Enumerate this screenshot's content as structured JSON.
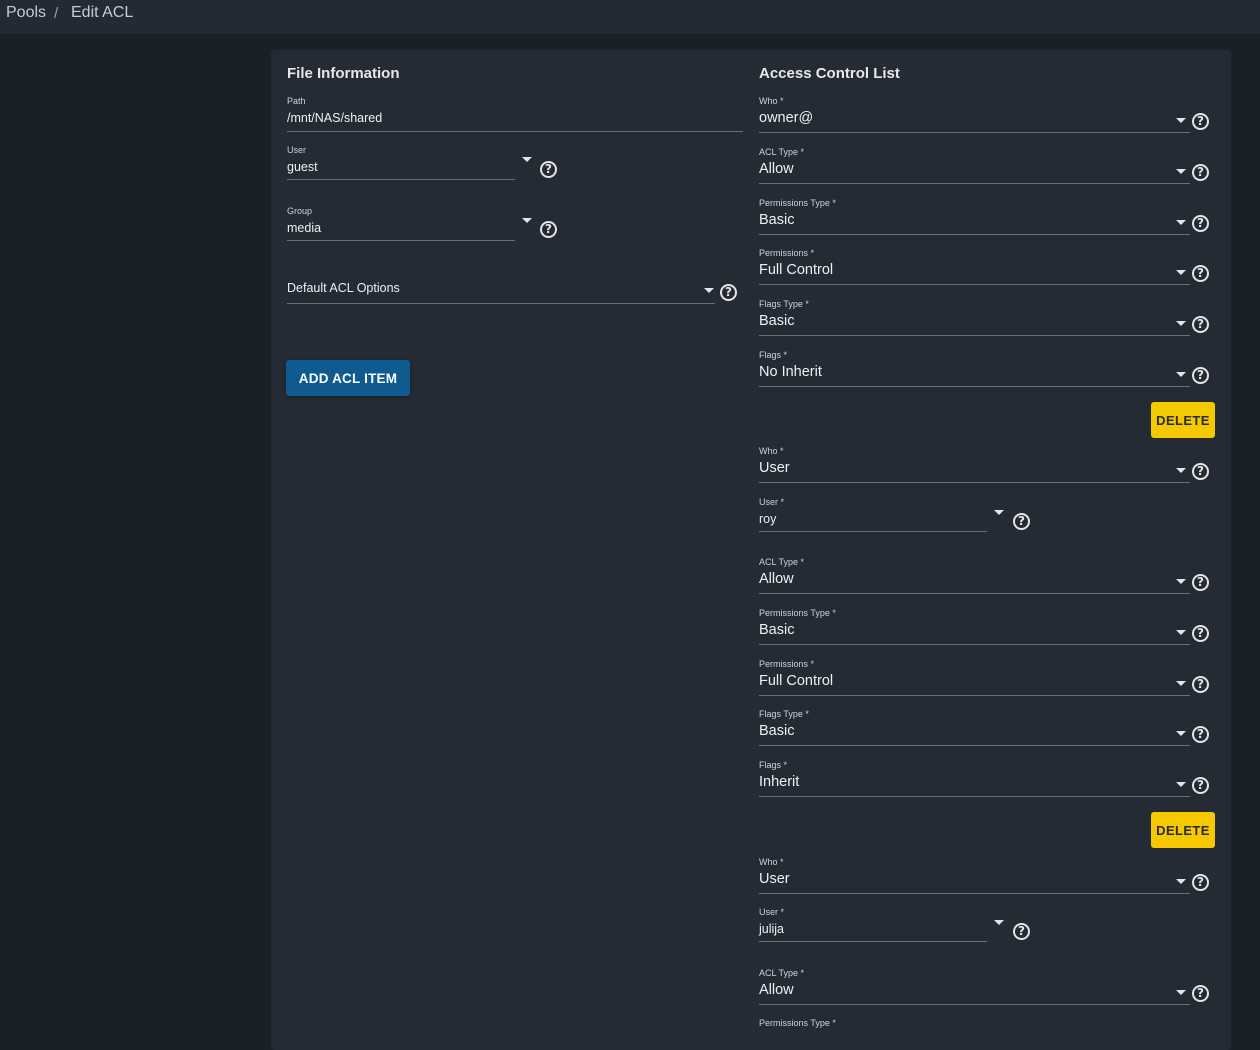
{
  "breadcrumb": {
    "root": "Pools",
    "separator": "/",
    "current": "Edit ACL"
  },
  "file_info": {
    "title": "File Information",
    "path_label": "Path",
    "path_value": "/mnt/NAS/shared",
    "user_label": "User",
    "user_value": "guest",
    "group_label": "Group",
    "group_value": "media",
    "default_acl_placeholder": "Default ACL Options",
    "add_button": "ADD ACL ITEM"
  },
  "acl": {
    "title": "Access Control List",
    "delete_label": "DELETE",
    "labels": {
      "who": "Who *",
      "user": "User *",
      "acl_type": "ACL Type *",
      "permissions_type": "Permissions Type *",
      "permissions": "Permissions *",
      "flags_type": "Flags Type *",
      "flags": "Flags *"
    },
    "items": [
      {
        "who": "owner@",
        "acl_type": "Allow",
        "permissions_type": "Basic",
        "permissions": "Full Control",
        "flags_type": "Basic",
        "flags": "No Inherit"
      },
      {
        "who": "User",
        "user": "roy",
        "acl_type": "Allow",
        "permissions_type": "Basic",
        "permissions": "Full Control",
        "flags_type": "Basic",
        "flags": "Inherit"
      },
      {
        "who": "User",
        "user": "julija",
        "acl_type": "Allow"
      }
    ]
  },
  "colors": {
    "primary_button": "#0f5a8f",
    "delete_button": "#f5c900",
    "card": "#242b34",
    "background": "#1a2027"
  }
}
